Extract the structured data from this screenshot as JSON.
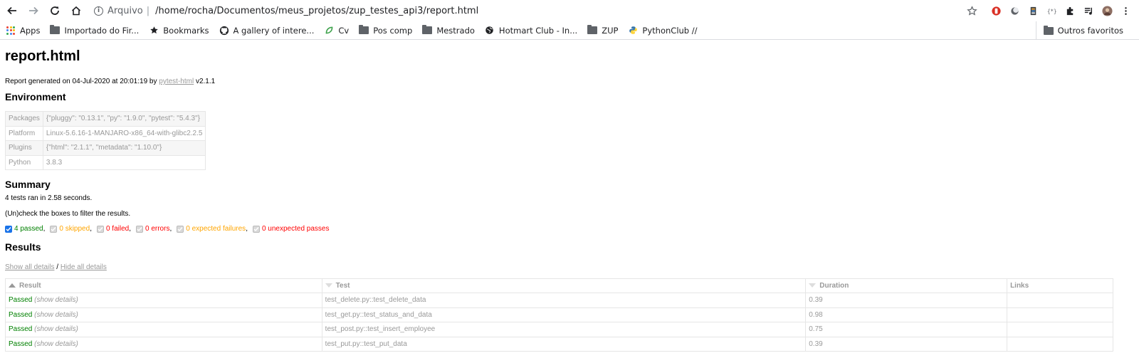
{
  "browser": {
    "omnibox": {
      "label": "Arquivo",
      "separator": "|",
      "url": "/home/rocha/Documentos/meus_projetos/zup_testes_api3/report.html"
    },
    "bookmarks": [
      {
        "label": "Apps",
        "icon": "apps-grid-icon"
      },
      {
        "label": "Importado do Fir...",
        "icon": "folder-icon"
      },
      {
        "label": "Bookmarks",
        "icon": "star-icon"
      },
      {
        "label": "A gallery of intere...",
        "icon": "github-icon"
      },
      {
        "label": "Cv",
        "icon": "leaf-icon"
      },
      {
        "label": "Pos comp",
        "icon": "folder-icon"
      },
      {
        "label": "Mestrado",
        "icon": "folder-icon"
      },
      {
        "label": "Hotmart Club - In...",
        "icon": "globe-icon"
      },
      {
        "label": "ZUP",
        "icon": "folder-icon"
      },
      {
        "label": "PythonClub //",
        "icon": "python-icon"
      }
    ],
    "other_bookmarks": "Outros favoritos"
  },
  "report": {
    "title": "report.html",
    "generated_prefix": "Report generated on 04-Jul-2020 at 20:01:19 by",
    "generated_link": "pytest-html",
    "generated_suffix": "v2.1.1",
    "environment_heading": "Environment",
    "environment": [
      {
        "key": "Packages",
        "value": "{\"pluggy\": \"0.13.1\", \"py\": \"1.9.0\", \"pytest\": \"5.4.3\"}"
      },
      {
        "key": "Platform",
        "value": "Linux-5.6.16-1-MANJARO-x86_64-with-glibc2.2.5"
      },
      {
        "key": "Plugins",
        "value": "{\"html\": \"2.1.1\", \"metadata\": \"1.10.0\"}"
      },
      {
        "key": "Python",
        "value": "3.8.3"
      }
    ],
    "summary_heading": "Summary",
    "summary_text": "4 tests ran in 2.58 seconds.",
    "filter_hint": "(Un)check the boxes to filter the results.",
    "filters": [
      {
        "label": "4 passed",
        "checked": true
      },
      {
        "label": "0 skipped",
        "checked": false
      },
      {
        "label": "0 failed",
        "checked": false
      },
      {
        "label": "0 errors",
        "checked": false
      },
      {
        "label": "0 expected failures",
        "checked": false
      },
      {
        "label": "0 unexpected passes",
        "checked": false
      }
    ],
    "results_heading": "Results",
    "show_all": "Show all details",
    "link_sep": "/",
    "hide_all": "Hide all details",
    "columns": [
      "Result",
      "Test",
      "Duration",
      "Links"
    ],
    "rows": [
      {
        "result": "Passed",
        "details": "(show details)",
        "test": "test_delete.py::test_delete_data",
        "duration": "0.39",
        "links": ""
      },
      {
        "result": "Passed",
        "details": "(show details)",
        "test": "test_get.py::test_status_and_data",
        "duration": "0.98",
        "links": ""
      },
      {
        "result": "Passed",
        "details": "(show details)",
        "test": "test_post.py::test_insert_employee",
        "duration": "0.75",
        "links": ""
      },
      {
        "result": "Passed",
        "details": "(show details)",
        "test": "test_put.py::test_put_data",
        "duration": "0.39",
        "links": ""
      }
    ]
  }
}
